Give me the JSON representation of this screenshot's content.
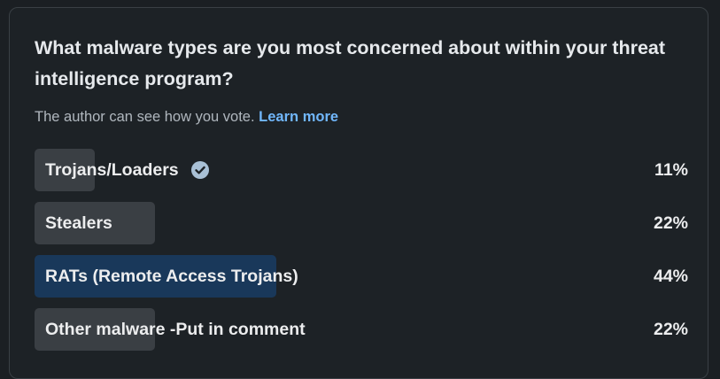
{
  "poll": {
    "question": "What malware types are you most concerned about within your threat intelligence program?",
    "meta_text": "The author can see how you vote.",
    "learn_more": "Learn more",
    "options": [
      {
        "label": "Trojans/Loaders",
        "percent_label": "11%",
        "percent": 11,
        "voted": true,
        "highlight": false
      },
      {
        "label": "Stealers",
        "percent_label": "22%",
        "percent": 22,
        "voted": false,
        "highlight": false
      },
      {
        "label": "RATs (Remote Access Trojans)",
        "percent_label": "44%",
        "percent": 44,
        "voted": false,
        "highlight": true
      },
      {
        "label": "Other malware -Put in comment",
        "percent_label": "22%",
        "percent": 22,
        "voted": false,
        "highlight": false
      }
    ]
  },
  "icons": {
    "voted_check": "check-circle-icon"
  },
  "colors": {
    "card_bg": "#1d2226",
    "bar": "#3a3f44",
    "bar_selected": "#19385a",
    "link": "#71b7fb",
    "check": "#a9c1d6"
  }
}
